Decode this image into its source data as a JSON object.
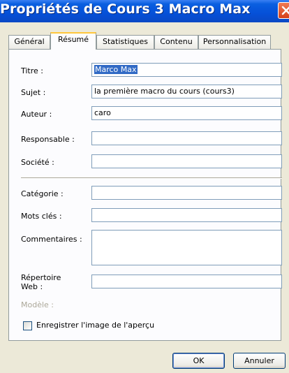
{
  "window": {
    "title": "Propriétés de Cours 3 Macro Max",
    "close_icon": "close-icon"
  },
  "tabs": [
    {
      "label": "Général",
      "active": false
    },
    {
      "label": "Résumé",
      "active": true
    },
    {
      "label": "Statistiques",
      "active": false
    },
    {
      "label": "Contenu",
      "active": false
    },
    {
      "label": "Personnalisation",
      "active": false
    }
  ],
  "fields": {
    "titre": {
      "label": "Titre :",
      "value": "Marco Max"
    },
    "sujet": {
      "label": "Sujet :",
      "value": "la première macro du cours (cours3)"
    },
    "auteur": {
      "label": "Auteur :",
      "value": "caro"
    },
    "responsable": {
      "label": "Responsable :",
      "value": ""
    },
    "societe": {
      "label": "Société :",
      "value": ""
    },
    "categorie": {
      "label": "Catégorie :",
      "value": ""
    },
    "mots_cles": {
      "label": "Mots clés :",
      "value": ""
    },
    "commentaires": {
      "label": "Commentaires :",
      "value": ""
    },
    "repertoire_web": {
      "label_line1": "Répertoire",
      "label_line2": "Web :",
      "value": ""
    },
    "modele": {
      "label": "Modèle :"
    }
  },
  "checkbox": {
    "label": "Enregistrer l'image de l'aperçu",
    "checked": false
  },
  "buttons": {
    "ok": "OK",
    "annuler": "Annuler"
  }
}
